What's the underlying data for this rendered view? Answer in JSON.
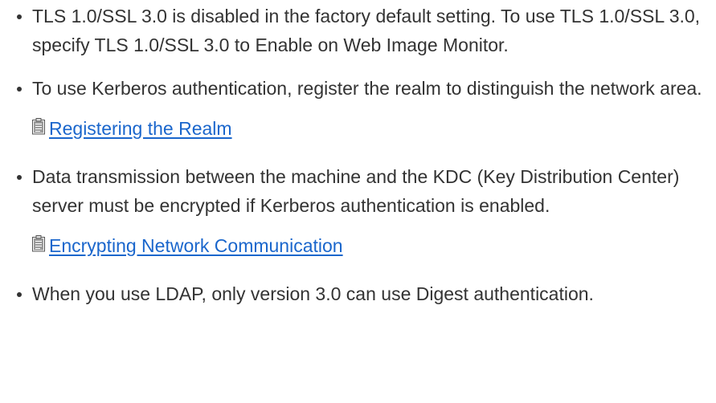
{
  "colors": {
    "text": "#333333",
    "link": "#1a66cc",
    "icon": "#666666"
  },
  "items": [
    {
      "text": "TLS 1.0/SSL 3.0 is disabled in the factory default setting. To use TLS 1.0/SSL 3.0, specify TLS 1.0/SSL 3.0 to Enable on Web Image Monitor."
    },
    {
      "text": "To use Kerberos authentication, register the realm to distinguish the network area.",
      "link": {
        "label": "Registering the Realm",
        "icon": "document-icon"
      }
    },
    {
      "text": "Data transmission between the machine and the KDC (Key Distribution Center) server must be encrypted if Kerberos authentication is enabled.",
      "link": {
        "label": "Encrypting Network Communication",
        "icon": "document-icon"
      }
    },
    {
      "text": "When you use LDAP, only version 3.0 can use Digest authentication."
    }
  ]
}
